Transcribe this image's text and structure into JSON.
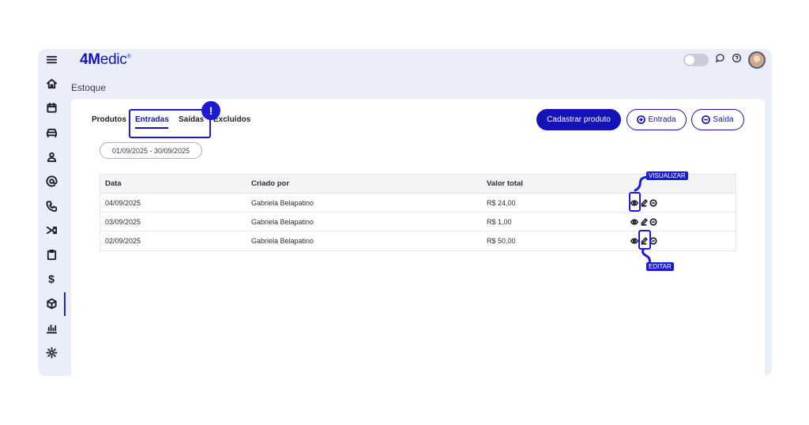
{
  "app": {
    "logo_bold": "4M",
    "logo_light": "edic",
    "logo_mark": "®"
  },
  "page": {
    "title": "Estoque"
  },
  "sidebar": {
    "items": [
      {
        "icon": "menu-icon"
      },
      {
        "icon": "home-icon"
      },
      {
        "icon": "calendar-icon"
      },
      {
        "icon": "sofa-icon"
      },
      {
        "icon": "user-icon"
      },
      {
        "icon": "at-icon"
      },
      {
        "icon": "phone-icon"
      },
      {
        "icon": "shuffle-icon"
      },
      {
        "icon": "clipboard-icon"
      },
      {
        "icon": "dollar-icon"
      },
      {
        "icon": "box-icon"
      },
      {
        "icon": "chart-icon"
      },
      {
        "icon": "gear-icon"
      }
    ],
    "dollar_glyph": "$"
  },
  "tabs": [
    "Produtos",
    "Entradas",
    "Saídas",
    "Excluídos"
  ],
  "tabs_active": "Entradas",
  "annotation_mark": "!",
  "buttons": {
    "register": "Cadastrar produto",
    "entry": "Entrada",
    "exit": "Saída"
  },
  "filter": {
    "date_range": "01/09/2025 - 30/09/2025"
  },
  "table": {
    "columns": [
      "Data",
      "Criado por",
      "Valor total"
    ],
    "rows": [
      [
        "04/09/2025",
        "Gabriela Belapatino",
        "R$ 24,00"
      ],
      [
        "03/09/2025",
        "Gabriela Belapatino",
        "R$ 1,00"
      ],
      [
        "02/09/2025",
        "Gabriela Belapatino",
        "R$ 50,00"
      ]
    ]
  },
  "callouts": {
    "view": "VISUALIZAR",
    "edit": "EDITAR"
  },
  "colors": {
    "brand": "#1413b8",
    "annotation": "#1b1bd6",
    "shell": "#e9eef9"
  }
}
